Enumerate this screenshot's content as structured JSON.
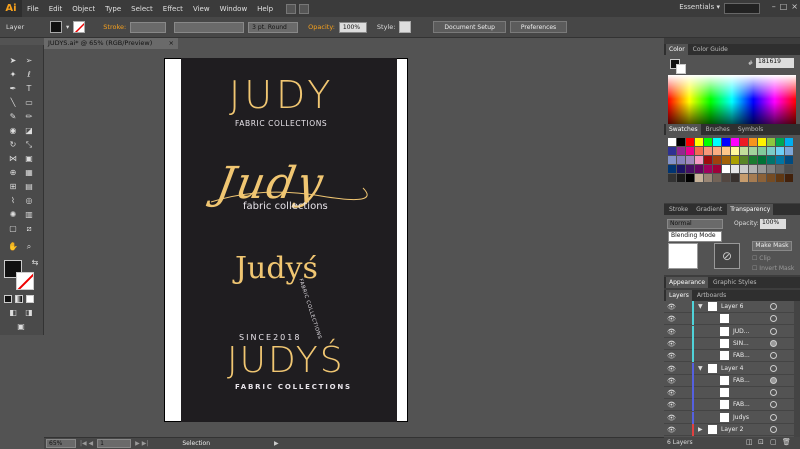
{
  "app": {
    "logo": "Ai"
  },
  "menu": [
    "File",
    "Edit",
    "Object",
    "Type",
    "Select",
    "Effect",
    "View",
    "Window",
    "Help"
  ],
  "workspace": "Essentials ▾",
  "control": {
    "selection_label": "Layer",
    "stroke_label": "Stroke:",
    "brush": "3 pt. Round",
    "opacity_label": "Opacity:",
    "opacity_value": "100%",
    "style_label": "Style:",
    "document_setup": "Document Setup",
    "preferences": "Preferences"
  },
  "document": {
    "tab_title": "JUDYS.ai* @ 65% (RGB/Preview)",
    "close": "×"
  },
  "artwork": {
    "logo1_title": "JUDY",
    "logo1_subtitle": "FABRIC COLLECTIONS",
    "logo2_script": "Judy",
    "logo2_subtitle": "fabric collections",
    "logo3_script": "Judyś",
    "logo3_arc": "FABRIC COLLECTIONS",
    "logo4_since": "SINCE2018",
    "logo4_title": "JUDYŚ",
    "logo4_subtitle": "FABRIC COLLECTIONS"
  },
  "status": {
    "zoom": "65%",
    "page": "1",
    "tool": "Selection"
  },
  "color_panel": {
    "tab_color": "Color",
    "tab_guide": "Color Guide",
    "hex": "181619"
  },
  "swatches_panel": {
    "tab_swatches": "Swatches",
    "tab_brushes": "Brushes",
    "tab_symbols": "Symbols"
  },
  "transparency_panel": {
    "tab_stroke": "Stroke",
    "tab_gradient": "Gradient",
    "tab_transparency": "Transparency",
    "blend_mode": "Normal",
    "opacity_label": "Opacity:",
    "opacity_value": "100%",
    "tooltip": "Blending Mode",
    "make_mask": "Make Mask",
    "clip": "Clip",
    "invert_mask": "Invert Mask"
  },
  "appearance_panel": {
    "tab_appearance": "Appearance",
    "tab_graphic_styles": "Graphic Styles"
  },
  "layers_panel": {
    "tab_layers": "Layers",
    "tab_artboards": "Artboards",
    "rows": [
      {
        "name": "Layer 6",
        "color": "#4fd3d9",
        "indent": 0,
        "expanded": true
      },
      {
        "name": "",
        "color": "#4fd3d9",
        "indent": 1
      },
      {
        "name": "JUD...",
        "color": "#4fd3d9",
        "indent": 1
      },
      {
        "name": "SIN...",
        "color": "#4fd3d9",
        "indent": 1
      },
      {
        "name": "FAB...",
        "color": "#4fd3d9",
        "indent": 1
      },
      {
        "name": "Layer 4",
        "color": "#5560e0",
        "indent": 0,
        "expanded": true
      },
      {
        "name": "FAB...",
        "color": "#5560e0",
        "indent": 1
      },
      {
        "name": "",
        "color": "#5560e0",
        "indent": 1
      },
      {
        "name": "FAB...",
        "color": "#5560e0",
        "indent": 1
      },
      {
        "name": "Judys",
        "color": "#5560e0",
        "indent": 1
      },
      {
        "name": "Layer 2",
        "color": "#e04040",
        "indent": 0,
        "expanded": false
      }
    ],
    "count": "6 Layers"
  }
}
